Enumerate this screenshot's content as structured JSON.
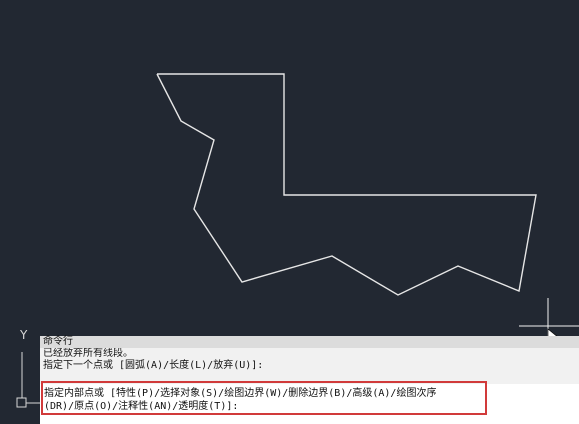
{
  "ucs": {
    "y_label": "Y"
  },
  "command_window": {
    "title": "命令行",
    "history": [
      "已经放弃所有线段。",
      "指定下一个点或 [圆弧(A)/长度(L)/放弃(U)]:"
    ],
    "current_prompt": [
      "指定内部点或 [特性(P)/选择对象(S)/绘图边界(W)/删除边界(B)/高级(A)/绘图次序",
      "(DR)/原点(O)/注释性(AN)/透明度(T)]:"
    ]
  },
  "colors": {
    "canvas_bg": "#222832",
    "polyline": "#e6e6e6",
    "highlight_box": "#d13a3a"
  }
}
